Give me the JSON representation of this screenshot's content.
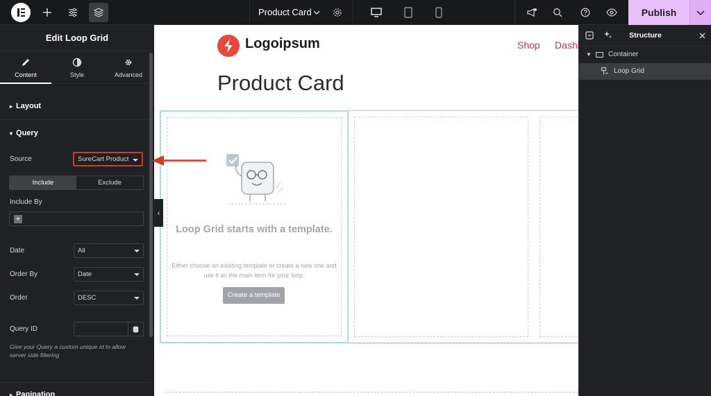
{
  "topbar": {
    "document_title": "Product Card",
    "publish_label": "Publish"
  },
  "panel": {
    "title": "Edit Loop Grid",
    "tabs": [
      {
        "label": "Content",
        "icon": "pencil-icon"
      },
      {
        "label": "Style",
        "icon": "half-circle-icon"
      },
      {
        "label": "Advanced",
        "icon": "gear-icon"
      }
    ],
    "sections": {
      "layout": "Layout",
      "query": "Query",
      "pagination": "Pagination"
    },
    "source_label": "Source",
    "source_value": "SureCart Product",
    "include_label": "Include",
    "exclude_label": "Exclude",
    "include_by_label": "Include By",
    "date_label": "Date",
    "date_value": "All",
    "order_by_label": "Order By",
    "order_by_value": "Date",
    "order_label": "Order",
    "order_value": "DESC",
    "query_id_label": "Query ID",
    "query_id_value": "",
    "query_id_note": "Give your Query a custom unique id to allow server side filtering"
  },
  "canvas": {
    "site_name": "Logoipsum",
    "nav": [
      "Shop",
      "Dashb"
    ],
    "page_title": "Product Card",
    "loop_grid_title": "Loop Grid starts with a template.",
    "loop_grid_desc": "Either choose an existing template or create a new one and use it as the main item for your loop.",
    "create_template_label": "Create a template"
  },
  "structure": {
    "title": "Structure",
    "items": [
      {
        "label": "Container",
        "icon": "container-icon"
      },
      {
        "label": "Loop Grid",
        "icon": "loop-grid-icon"
      }
    ]
  },
  "colors": {
    "accent": "#e9c0f9",
    "highlight": "#d23a28",
    "nav_link": "#c0355c",
    "brand": "#e8473d"
  }
}
